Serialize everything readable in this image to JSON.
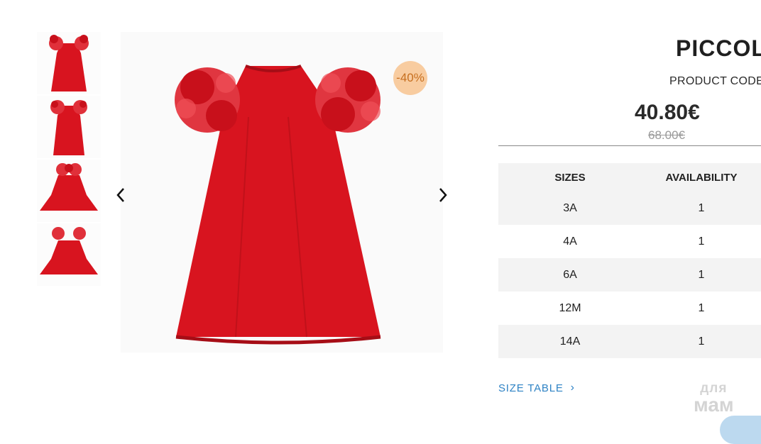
{
  "gallery": {
    "thumbnails": [
      {
        "icon": "red-dress-front-thumbnail"
      },
      {
        "icon": "red-dress-back-thumbnail"
      },
      {
        "icon": "red-dress-flat-thumbnail"
      },
      {
        "icon": "red-dress-flat-back-thumbnail"
      }
    ],
    "main_image_icon": "red-velvet-dress-image",
    "prev_icon": "chevron-left-icon",
    "next_icon": "chevron-right-icon",
    "discount_badge": "-40%"
  },
  "product": {
    "title": "PICCOLA",
    "code_label": "PRODUCT CODE:",
    "price": "40.80€",
    "old_price": "68.00€"
  },
  "sizes_table": {
    "headers": {
      "size": "SIZES",
      "availability": "AVAILABILITY"
    },
    "rows": [
      {
        "size": "3A",
        "availability": "1"
      },
      {
        "size": "4A",
        "availability": "1"
      },
      {
        "size": "6A",
        "availability": "1"
      },
      {
        "size": "12M",
        "availability": "1"
      },
      {
        "size": "14A",
        "availability": "1"
      }
    ]
  },
  "size_table_link": {
    "label": "SIZE TABLE",
    "chevron": "›"
  },
  "watermark": {
    "line1": "для",
    "line2": "мам"
  },
  "colors": {
    "dress": "#d8141f",
    "badge_bg": "#f8cca0",
    "badge_text": "#c76f1f",
    "link": "#2f83c5"
  }
}
